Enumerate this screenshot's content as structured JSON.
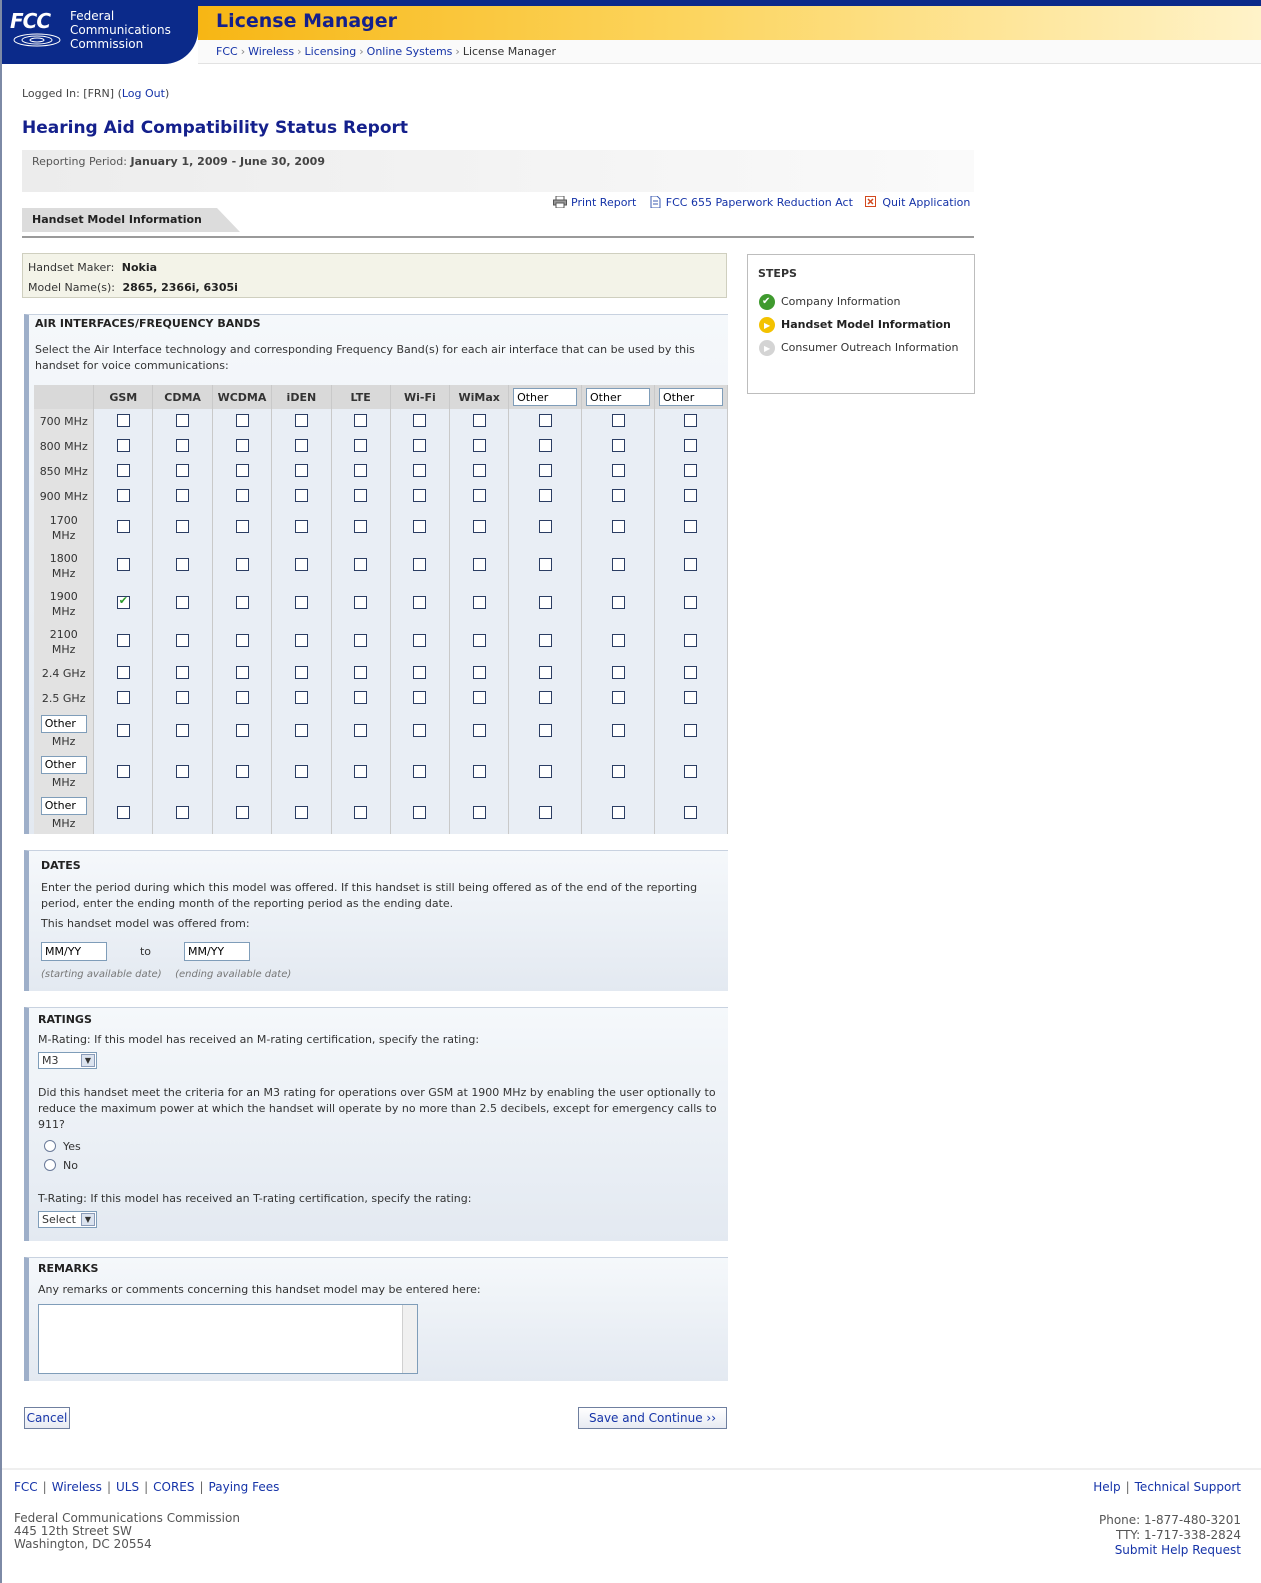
{
  "header": {
    "logo_mark": "FCC",
    "agency_line1": "Federal",
    "agency_line2": "Communications",
    "agency_line3": "Commission",
    "app_title": "License Manager",
    "breadcrumb": [
      "FCC",
      "Wireless",
      "Licensing",
      "Online Systems",
      "License Manager"
    ]
  },
  "session": {
    "prefix": "Logged In: [FRN] (",
    "logout": "Log Out",
    "suffix": ")"
  },
  "page_title": "Hearing Aid Compatibility Status Report",
  "period": {
    "label": "Reporting Period:",
    "value": "January 1, 2009 - June 30, 2009"
  },
  "toolbar": {
    "print": "Print Report",
    "paperwork": "FCC 655 Paperwork Reduction Act",
    "quit": "Quit Application"
  },
  "section_tab": "Handset Model Information",
  "maker": {
    "maker_label": "Handset Maker:",
    "maker_value": "Nokia",
    "model_label": "Model Name(s):",
    "model_value": "2865, 2366i, 6305i"
  },
  "steps": {
    "title": "STEPS",
    "items": [
      {
        "label": "Company Information",
        "state": "done"
      },
      {
        "label": "Handset Model Information",
        "state": "current"
      },
      {
        "label": "Consumer Outreach Information",
        "state": "todo"
      }
    ]
  },
  "air": {
    "title": "AIR INTERFACES/FREQUENCY BANDS",
    "description": "Select the Air Interface technology and corresponding Frequency Band(s) for each air interface that can be used by this handset for voice communications:",
    "columns": [
      "GSM",
      "CDMA",
      "WCDMA",
      "iDEN",
      "LTE",
      "Wi-Fi",
      "WiMax"
    ],
    "other_column_value": "Other",
    "rows": [
      "700 MHz",
      "800 MHz",
      "850 MHz",
      "900 MHz",
      "1700 MHz",
      "1800 MHz",
      "1900 MHz",
      "2100 MHz",
      "2.4 GHz",
      "2.5 GHz"
    ],
    "other_row_value": "Other",
    "other_row_unit": "MHz",
    "checked": [
      {
        "row": "1900 MHz",
        "column": "GSM"
      }
    ]
  },
  "dates": {
    "title": "DATES",
    "description": "Enter the period during which this model was offered. If this handset is still being offered as of the end of the reporting period, enter the ending month of the reporting period as the ending date.",
    "offered_from": "This handset model was offered from:",
    "start_value": "MM/YY",
    "to": "to",
    "end_value": "MM/YY",
    "start_hint": "(starting available date)",
    "end_hint": "(ending available date)"
  },
  "ratings": {
    "title": "RATINGS",
    "m_prompt": "M-Rating: If this model has received an M-rating certification, specify the rating:",
    "m_value": "M3",
    "gsm_question": "Did this handset meet the criteria for an M3 rating for operations over GSM at 1900 MHz by enabling the user optionally to reduce the maximum power at which the handset will operate by no more than 2.5 decibels, except for emergency calls to 911?",
    "yes": "Yes",
    "no": "No",
    "t_prompt": "T-Rating: If this model has received an T-rating certification, specify the rating:",
    "t_value": "Select"
  },
  "remarks": {
    "title": "REMARKS",
    "prompt": "Any remarks or comments concerning this handset model may be entered here:"
  },
  "buttons": {
    "cancel": "Cancel",
    "save": "Save and Continue ››"
  },
  "footer": {
    "links": [
      "FCC",
      "Wireless",
      "ULS",
      "CORES",
      "Paying Fees"
    ],
    "help": "Help",
    "tech_support": "Technical Support",
    "address": [
      "Federal Communications Commission",
      "445 12th Street SW",
      "Washington, DC 20554"
    ],
    "phone": "Phone: 1-877-480-3201",
    "tty": "TTY: 1-717-338-2824",
    "submit_help": "Submit Help Request"
  },
  "colors": {
    "brand_blue": "#0b2a8a",
    "title_blue": "#14208c",
    "link_blue": "#1533a8",
    "accent_gold": "#f7b614"
  }
}
